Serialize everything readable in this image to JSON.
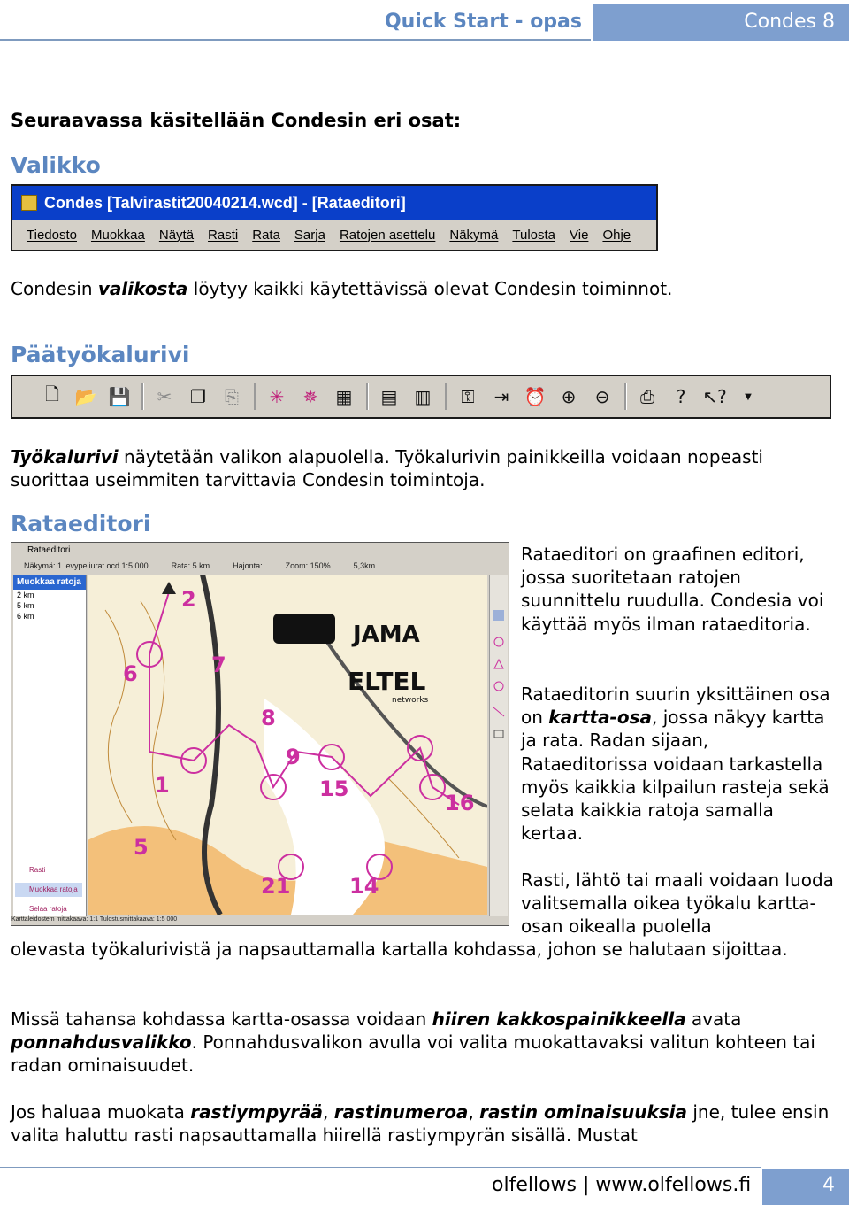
{
  "header": {
    "title": "Quick Start - opas",
    "product": "Condes 8"
  },
  "intro": "Seuraavassa käsitellään Condesin eri osat:",
  "valikko": {
    "heading": "Valikko",
    "window_title": "Condes [Talvirastit20040214.wcd] - [Rataeditori]",
    "menu_items": [
      "Tiedosto",
      "Muokkaa",
      "Näytä",
      "Rasti",
      "Rata",
      "Sarja",
      "Ratojen asettelu",
      "Näkymä",
      "Tulosta",
      "Vie",
      "Ohje"
    ],
    "text": {
      "a": "Condesin ",
      "b": "valikosta",
      "c": " löytyy kaikki käytettävissä olevat Condesin toiminnot."
    }
  },
  "toolbar": {
    "heading": "Päätyökalurivi",
    "icons": [
      "new-icon",
      "open-icon",
      "save-icon",
      "cut-icon",
      "copy-icon",
      "paste-icon",
      "add-control-icon",
      "add-course-icon",
      "grid-icon",
      "table-icon",
      "table2-icon",
      "key-icon",
      "export-icon",
      "alarm-icon",
      "zoom-in-icon",
      "zoom-out-icon",
      "print-icon",
      "help-icon",
      "context-help-icon"
    ],
    "text": {
      "a": "Työkalurivi",
      "b": " näytetään valikon alapuolella. Työkalurivin painikkeilla voidaan nopeasti suorittaa useimmiten tarvittavia Condesin toimintoja."
    }
  },
  "rataeditori": {
    "heading": "Rataeditori",
    "editor": {
      "title": "Rataeditori",
      "toolbar": [
        "Näkymä: 1 levypeliurat.ocd  1:5 000",
        "Rata: 5 km",
        "Hajonta:",
        "Zoom: 150%",
        "5,3km"
      ],
      "panel_header": "Muokkaa ratoja",
      "panel_items": [
        "2 km",
        "5 km",
        "6 km"
      ],
      "panel_buttons": [
        "Rasti",
        "Muokkaa ratoja",
        "Selaa ratoja"
      ],
      "status": "Karttaleidostem mittakaava: 1:1 Tulostusmittakaava: 1:5 000",
      "control_numbers": [
        "2",
        "7",
        "6",
        "8",
        "9",
        "1",
        "15",
        "16",
        "5",
        "21",
        "14"
      ],
      "sponsors": [
        "JAMA",
        "ELTEL",
        "networks"
      ]
    },
    "p1": "Rataeditori on graafinen editori, jossa suoritetaan ratojen suunnittelu ruudulla. Condesia voi käyttää myös ilman rataeditoria.",
    "p2": {
      "a": "Rataeditorin suurin yksittäinen osa on ",
      "b": "kartta-osa",
      "c": ", jossa näkyy kartta ja rata. Radan sijaan, Rataeditorissa voidaan tarkastella myös kaikkia kilpailun rasteja sekä selata kaikkia ratoja samalla kertaa."
    },
    "p3_right": "Rasti, lähtö tai maali voidaan luoda valitsemalla oikea työkalu kartta-osan oikealla puolella",
    "p3_full": "olevasta työkalurivistä ja napsauttamalla kartalla kohdassa, johon se halutaan sijoittaa."
  },
  "popup": {
    "a": "Missä tahansa kohdassa kartta-osassa voidaan ",
    "b": "hiiren kakkospainikkeella",
    "c": " avata ",
    "d": "ponnahdusvalikko",
    "e": ". Ponnahdusvalikon avulla voi valita muokattavaksi valitun kohteen tai radan ominaisuudet."
  },
  "edit": {
    "a": "Jos haluaa muokata ",
    "b": "rastiympyrää",
    "c": ", ",
    "d": "rastinumeroa",
    "e": ", ",
    "f": "rastin ominaisuuksia",
    "g": " jne, tulee ensin valita haluttu rasti napsauttamalla hiirellä rastiympyrän sisällä. Mustat"
  },
  "footer": {
    "text": "olfellows | www.olfellows.fi",
    "page": "4"
  }
}
